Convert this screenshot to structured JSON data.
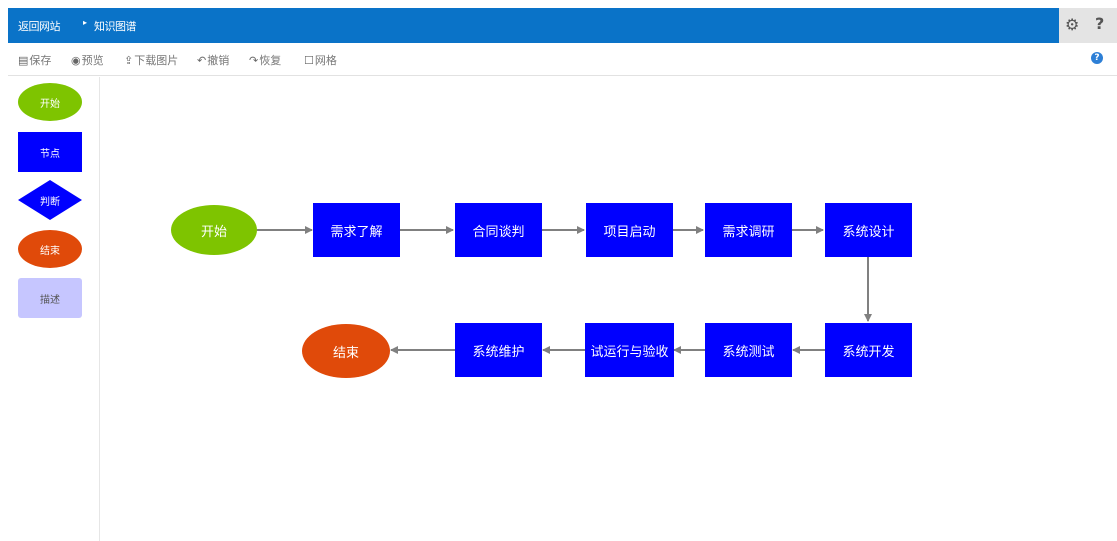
{
  "header": {
    "back_label": "返回网站",
    "separator": "▸",
    "current_label": "知识图谱"
  },
  "toolbar": {
    "save": "保存",
    "preview": "预览",
    "download": "下载图片",
    "undo": "撤销",
    "redo": "恢复",
    "grid": "网格",
    "help": "?"
  },
  "palette": {
    "start": "开始",
    "node": "节点",
    "decision": "判断",
    "end": "结束",
    "description": "描述"
  },
  "flow": {
    "start": "开始",
    "n1": "需求了解",
    "n2": "合同谈判",
    "n3": "项目启动",
    "n4": "需求调研",
    "n5": "系统设计",
    "n6": "系统开发",
    "n7": "系统测试",
    "n8": "试运行与验收",
    "n9": "系统维护",
    "end": "结束"
  },
  "colors": {
    "header": "#0a73c8",
    "start": "#7ec400",
    "node": "#0000ff",
    "end": "#e04a0a",
    "description": "#c6c6ff",
    "arrow": "#808080"
  }
}
